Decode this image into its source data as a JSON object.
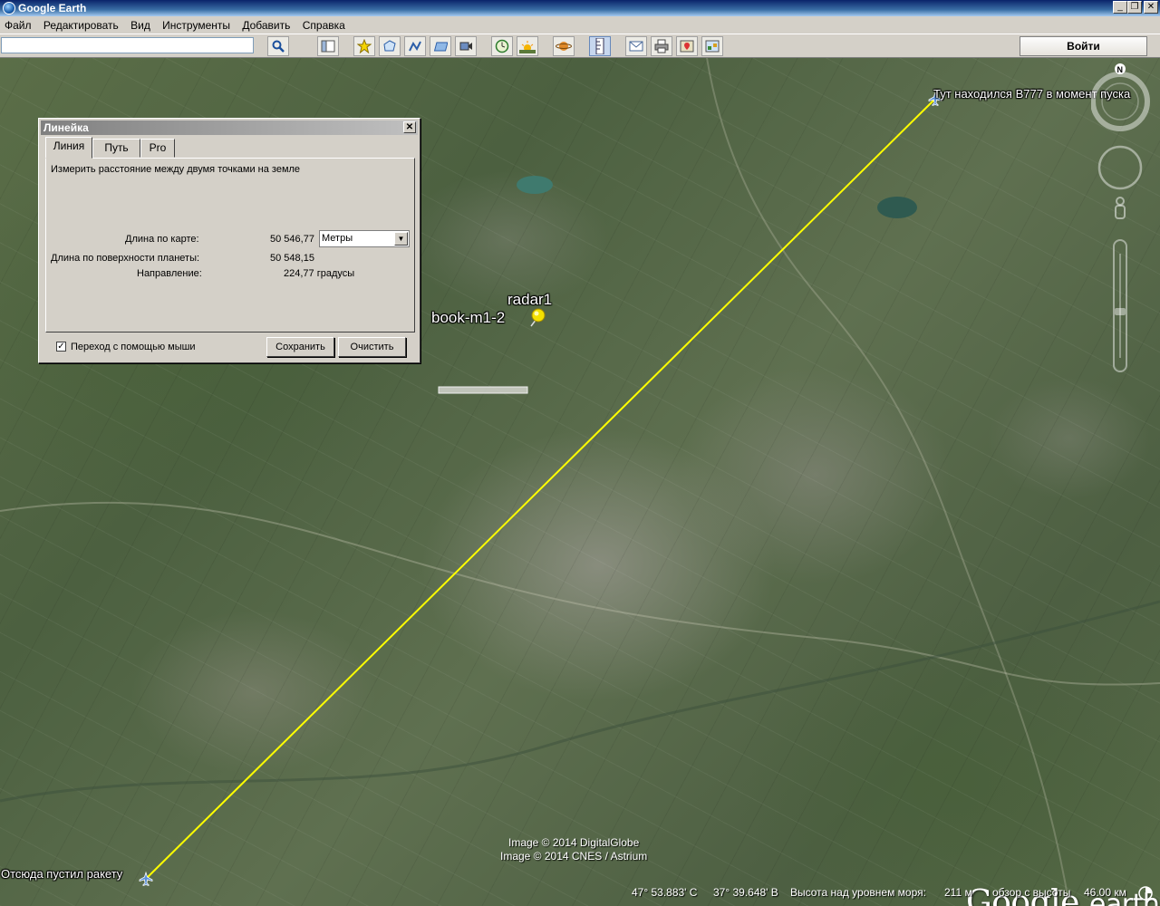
{
  "window": {
    "title": "Google Earth",
    "minimize": "_",
    "restore": "❐",
    "close": "✕"
  },
  "menu": {
    "items": [
      "Файл",
      "Редактировать",
      "Вид",
      "Инструменты",
      "Добавить",
      "Справка"
    ]
  },
  "toolbar": {
    "search_value": "",
    "login_label": "Войти",
    "icons": [
      "search-icon",
      "sidebar-icon",
      "placemark-icon",
      "polygon-icon",
      "path-icon",
      "overlay-icon",
      "tour-icon",
      "historical-imagery-icon",
      "sunlight-icon",
      "planets-icon",
      "ruler-icon",
      "email-icon",
      "print-icon",
      "maps-icon",
      "save-image-icon"
    ]
  },
  "map": {
    "labels": {
      "b777": "Тут находился B777 в момент пуска",
      "launch": "Отсюда пустил ракету",
      "radar": "radar1",
      "book": "book-m1-2"
    },
    "measure_line_color": "#ffff00",
    "compass_north": "N",
    "credits": [
      "Image © 2014 DigitalGlobe",
      "Image © 2014 CNES / Astrium"
    ],
    "logo": {
      "google": "Google",
      "earth": "earth"
    }
  },
  "ruler": {
    "title": "Линейка",
    "close": "✕",
    "tabs": [
      "Линия",
      "Путь",
      "Pro"
    ],
    "active_tab": "Линия",
    "description": "Измерить расстояние между двумя точками на земле",
    "map_length_label": "Длина по карте:",
    "map_length_value": "50 546,77",
    "units": "Метры",
    "ground_length_label": "Длина по поверхности планеты:",
    "ground_length_value": "50 548,15",
    "heading_label": "Направление:",
    "heading_value": "224,77 градусы",
    "mouse_nav_label": "Переход с помощью мыши",
    "mouse_nav_checked": true,
    "checkmark": "✓",
    "save_label": "Сохранить",
    "clear_label": "Очистить"
  },
  "status": {
    "lat": "47° 53.883' С",
    "lon": "37° 39.648' В",
    "elevation_label": "Высота над уровнем моря:",
    "elevation_value": "211 м",
    "eye_alt_label": "обзор с высоты",
    "eye_alt_value": "46.00 км"
  }
}
